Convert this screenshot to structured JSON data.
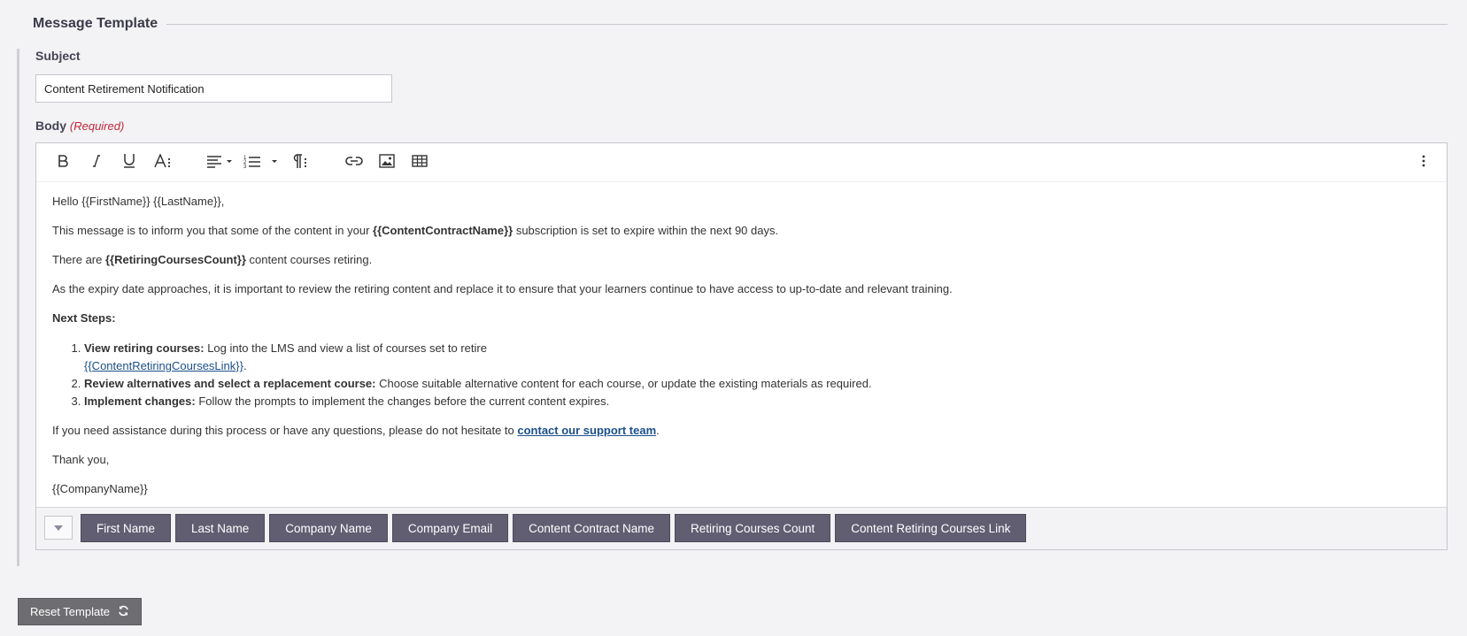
{
  "section": {
    "title": "Message Template"
  },
  "subject": {
    "label": "Subject",
    "value": "Content Retirement Notification"
  },
  "body": {
    "label": "Body",
    "required": "(Required)"
  },
  "toolbar": {
    "items": [
      "bold-icon",
      "italic-icon",
      "underline-icon",
      "font-size-icon",
      "align-icon",
      "ordered-list-icon",
      "paragraph-format-icon",
      "link-icon",
      "image-icon",
      "table-icon",
      "more-vertical-icon"
    ]
  },
  "content": {
    "greeting": "Hello {{FirstName}} {{LastName}},",
    "p1_pre": "This message is to inform you that some of the content in your ",
    "p1_bold": "{{ContentContractName}}",
    "p1_post": " subscription is set to expire within the next 90 days.",
    "p2_pre": "There are ",
    "p2_bold": "{{RetiringCoursesCount}}",
    "p2_post": " content courses retiring.",
    "p3": "As the expiry date approaches, it is important to review the retiring content and replace it to ensure that your learners continue to have access to up-to-date and relevant training.",
    "next_steps": "Next Steps:",
    "steps": [
      {
        "bold": "View retiring courses:",
        "text": " Log into the LMS and view a list of courses set to retire",
        "link": "{{ContentRetiringCoursesLink}}",
        "after": "."
      },
      {
        "bold": "Review alternatives and select a replacement course:",
        "text": " Choose suitable alternative content for each course, or update the existing materials as required."
      },
      {
        "bold": "Implement changes:",
        "text": " Follow the prompts to implement the changes before the current content expires."
      }
    ],
    "p4_pre": "If you need assistance during this process or have any questions, please do not hesitate to ",
    "p4_link": "contact our support team",
    "p4_post": ".",
    "thanks": "Thank you,",
    "signature": "{{CompanyName}}"
  },
  "merge_tags": [
    "First Name",
    "Last Name",
    "Company Name",
    "Company Email",
    "Content Contract Name",
    "Retiring Courses Count",
    "Content Retiring Courses Link"
  ],
  "reset": {
    "label": "Reset Template",
    "icon": "refresh-icon"
  },
  "colors": {
    "tag_bg": "#615e72",
    "link": "#1b4f8a",
    "required": "#c0283b",
    "reset_bg": "#6e6e72"
  }
}
